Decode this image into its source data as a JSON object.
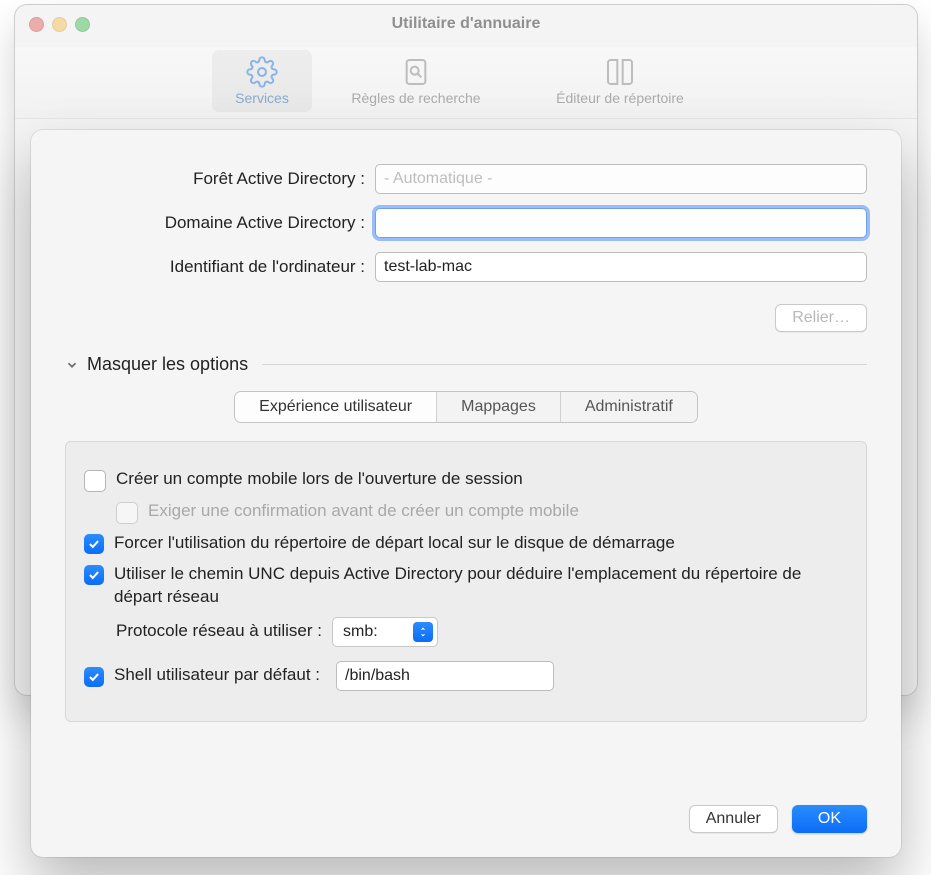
{
  "window": {
    "title": "Utilitaire d'annuaire",
    "toolbar": [
      {
        "label": "Services",
        "active": true,
        "icon": "gear"
      },
      {
        "label": "Règles de recherche",
        "active": false,
        "icon": "search-doc"
      },
      {
        "label": "Éditeur de répertoire",
        "active": false,
        "icon": "book"
      }
    ]
  },
  "form": {
    "forest_label": "Forêt Active Directory :",
    "forest_value": "- Automatique -",
    "domain_label": "Domaine Active Directory :",
    "domain_value": "",
    "computer_id_label": "Identifiant de l'ordinateur :",
    "computer_id_value": "test-lab-mac",
    "bind_button": "Relier…"
  },
  "disclosure": {
    "label": "Masquer les options"
  },
  "tabs": [
    {
      "label": "Expérience utilisateur",
      "active": true
    },
    {
      "label": "Mappages",
      "active": false
    },
    {
      "label": "Administratif",
      "active": false
    }
  ],
  "options": {
    "create_mobile": {
      "label": "Créer un compte mobile lors de l'ouverture de session",
      "checked": false
    },
    "require_confirm": {
      "label": "Exiger une confirmation avant de créer un compte mobile",
      "checked": false,
      "disabled": true
    },
    "force_local_home": {
      "label": "Forcer l'utilisation du répertoire de départ local sur le disque de démarrage",
      "checked": true
    },
    "use_unc": {
      "label": "Utiliser le chemin UNC depuis Active Directory pour déduire l'emplacement du répertoire de départ réseau",
      "checked": true
    },
    "protocol_label": "Protocole réseau à utiliser :",
    "protocol_value": "smb:",
    "default_shell": {
      "label": "Shell utilisateur par défaut :",
      "checked": true
    },
    "default_shell_value": "/bin/bash"
  },
  "footer": {
    "cancel": "Annuler",
    "ok": "OK"
  }
}
